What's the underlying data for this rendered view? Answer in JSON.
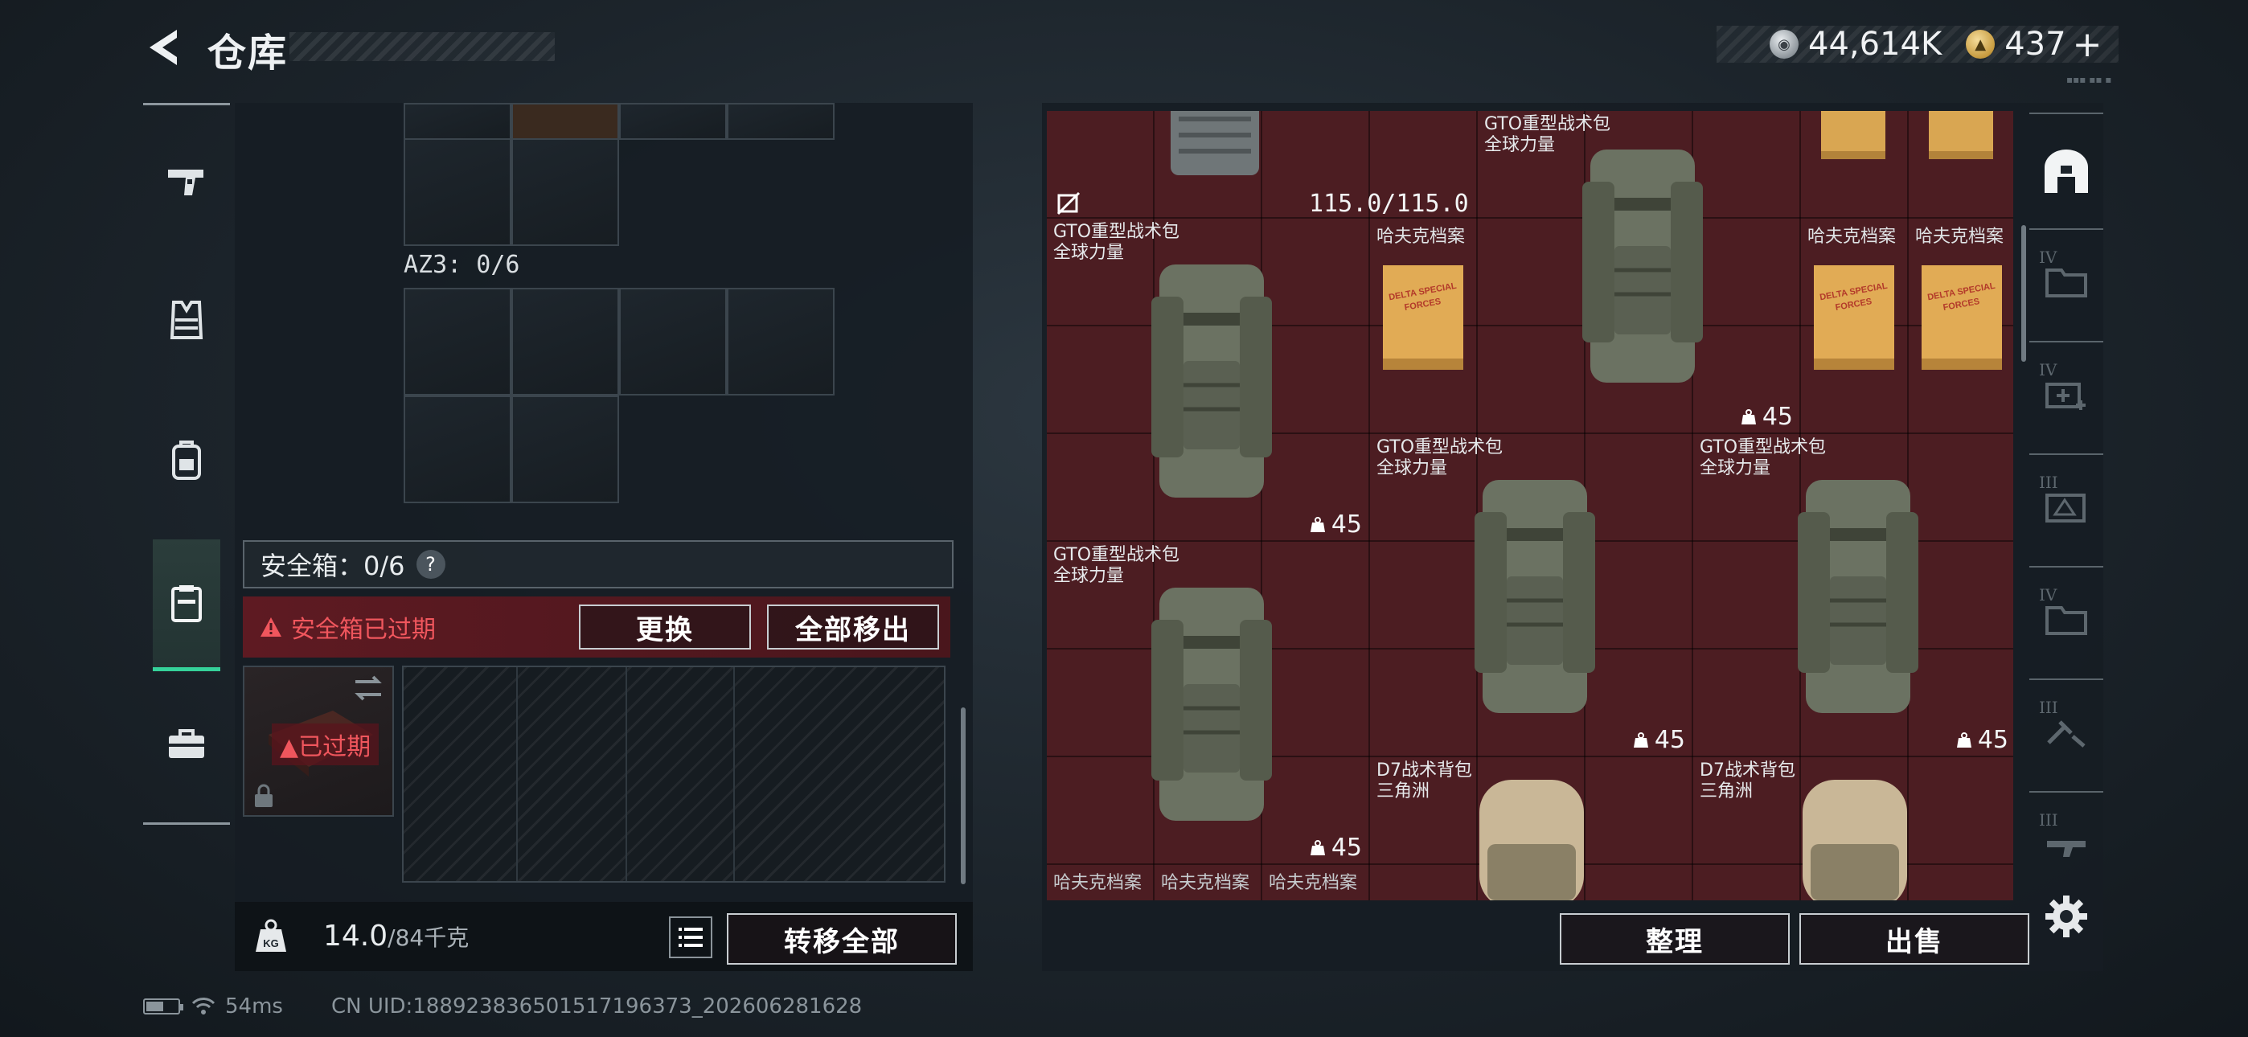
{
  "header": {
    "title": "仓库",
    "currency": [
      {
        "icon": "silver-coin-icon",
        "value": "44,614K"
      },
      {
        "icon": "gold-coin-icon",
        "value": "437"
      }
    ],
    "add_label": "+"
  },
  "left_rail": {
    "items": [
      {
        "name": "weapon-icon",
        "active": false
      },
      {
        "name": "vest-icon",
        "active": false
      },
      {
        "name": "backpack-icon",
        "active": false
      },
      {
        "name": "secure-container-icon",
        "active": true
      },
      {
        "name": "toolbox-icon",
        "active": false
      }
    ]
  },
  "left_panel": {
    "az3_label": "AZ3: 0/6",
    "safebox_label": "安全箱：0/6",
    "help_label": "?",
    "expired_notice": "安全箱已过期",
    "replace_button": "更换",
    "remove_all_button": "全部移出",
    "case_expired_label": "已过期",
    "weight_value": "14.0",
    "weight_max": "/84千克",
    "weight_icon_label": "KG",
    "transfer_all_button": "转移全部"
  },
  "stash": {
    "durability": "115.0/115.0",
    "items": [
      {
        "name": "GTO重型战术包",
        "brand": "全球力量",
        "count": "45"
      },
      {
        "name": "GTO重型战术包",
        "brand": "全球力量",
        "count": "45"
      },
      {
        "name": "GTO重型战术包",
        "brand": "全球力量",
        "count": "45"
      },
      {
        "name": "GTO重型战术包",
        "brand": "全球力量",
        "count": "45"
      },
      {
        "name": "GTO重型战术包",
        "brand": "全球力量",
        "count": "45"
      },
      {
        "name": "D7战术背包",
        "brand": "三角洲"
      },
      {
        "name": "D7战术背包",
        "brand": "三角洲"
      }
    ],
    "files": [
      {
        "name": "哈夫克档案",
        "cover": "DELTA SPECIAL FORCES"
      },
      {
        "name": "哈夫克档案",
        "cover": "DELTA SPECIAL FORCES"
      },
      {
        "name": "哈夫克档案",
        "cover": "DELTA SPECIAL FORCES"
      }
    ],
    "bottom_labels": [
      "哈夫克档案",
      "哈夫克档案",
      "哈夫克档案"
    ],
    "sort_button": "整理",
    "sell_button": "出售"
  },
  "side_rail": {
    "items": [
      {
        "name": "stash-home-icon",
        "tier": ""
      },
      {
        "name": "folder-tier-icon",
        "tier": "IV"
      },
      {
        "name": "medkit-tier-icon",
        "tier": "IV"
      },
      {
        "name": "ammo-tier-icon",
        "tier": "III"
      },
      {
        "name": "folder-tier-icon",
        "tier": "IV"
      },
      {
        "name": "tools-tier-icon",
        "tier": "III"
      },
      {
        "name": "weapon-tier-icon",
        "tier": "III"
      }
    ]
  },
  "status_bar": {
    "ping": "54ms",
    "uid": "CN UID:18892383650151719637​3_202606281628",
    "battery_level": 0.55
  },
  "colors": {
    "accent_green": "#35d29a",
    "warning_red": "#f0565d",
    "stash_bg": "#4c1d22"
  }
}
